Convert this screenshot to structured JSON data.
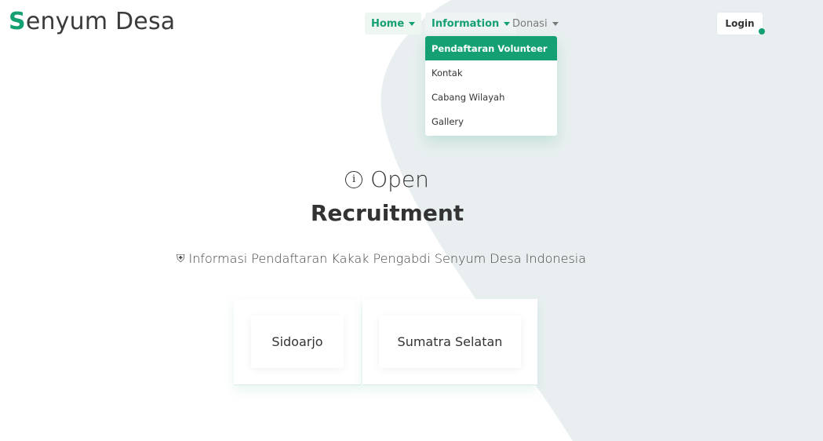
{
  "brand": {
    "accent_letter": "S",
    "rest": "enyum Desa"
  },
  "nav": {
    "home": "Home",
    "information": "Information",
    "donasi": "Donasi",
    "login": "Login"
  },
  "dropdown": {
    "items": [
      "Pendaftaran Volunteer",
      "Kontak",
      "Cabang Wilayah",
      "Gallery"
    ]
  },
  "hero": {
    "line1": "Open",
    "line2": "Recruitment",
    "subtitle": "Informasi Pendaftaran Kakak Pengabdi Senyum Desa Indonesia"
  },
  "cards": [
    {
      "label": "Sidoarjo"
    },
    {
      "label": "Sumatra Selatan"
    }
  ],
  "icons": {
    "info": "info-circle-icon",
    "megaphone": "megaphone-icon",
    "caret": "caret-down-icon"
  },
  "colors": {
    "accent": "#14a073",
    "background_shape": "#e9eff0"
  }
}
